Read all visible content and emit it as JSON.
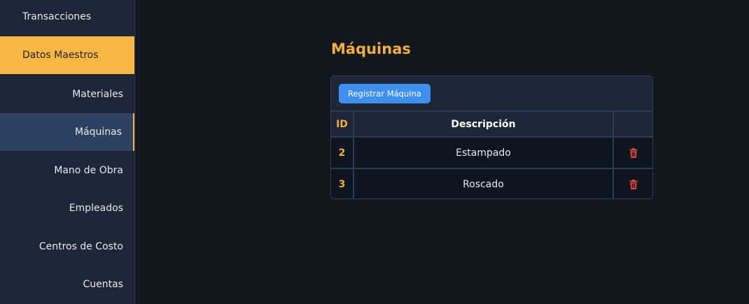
{
  "sidebar": {
    "items": [
      {
        "label": "Transacciones",
        "state": "default",
        "level": "top"
      },
      {
        "label": "Datos Maestros",
        "state": "expanded",
        "level": "top"
      },
      {
        "label": "Materiales",
        "state": "default",
        "level": "sub"
      },
      {
        "label": "Máquinas",
        "state": "selected",
        "level": "sub"
      },
      {
        "label": "Mano de Obra",
        "state": "default",
        "level": "sub"
      },
      {
        "label": "Empleados",
        "state": "default",
        "level": "sub"
      },
      {
        "label": "Centros de Costo",
        "state": "default",
        "level": "sub"
      },
      {
        "label": "Cuentas",
        "state": "default",
        "level": "sub"
      }
    ]
  },
  "main": {
    "title": "Máquinas",
    "register_button": "Registrar Máquina",
    "table": {
      "headers": [
        "ID",
        "Descripción",
        ""
      ],
      "rows": [
        {
          "id": "2",
          "description": "Estampado",
          "action_icon": "trash-icon"
        },
        {
          "id": "3",
          "description": "Roscado",
          "action_icon": "trash-icon"
        }
      ]
    }
  },
  "colors": {
    "accent": "#fbb744",
    "title": "#f5ae3f",
    "primary_button": "#3f8ff0",
    "danger": "#e5483c",
    "sidebar_bg": "#1d2738",
    "page_bg": "#111820"
  }
}
